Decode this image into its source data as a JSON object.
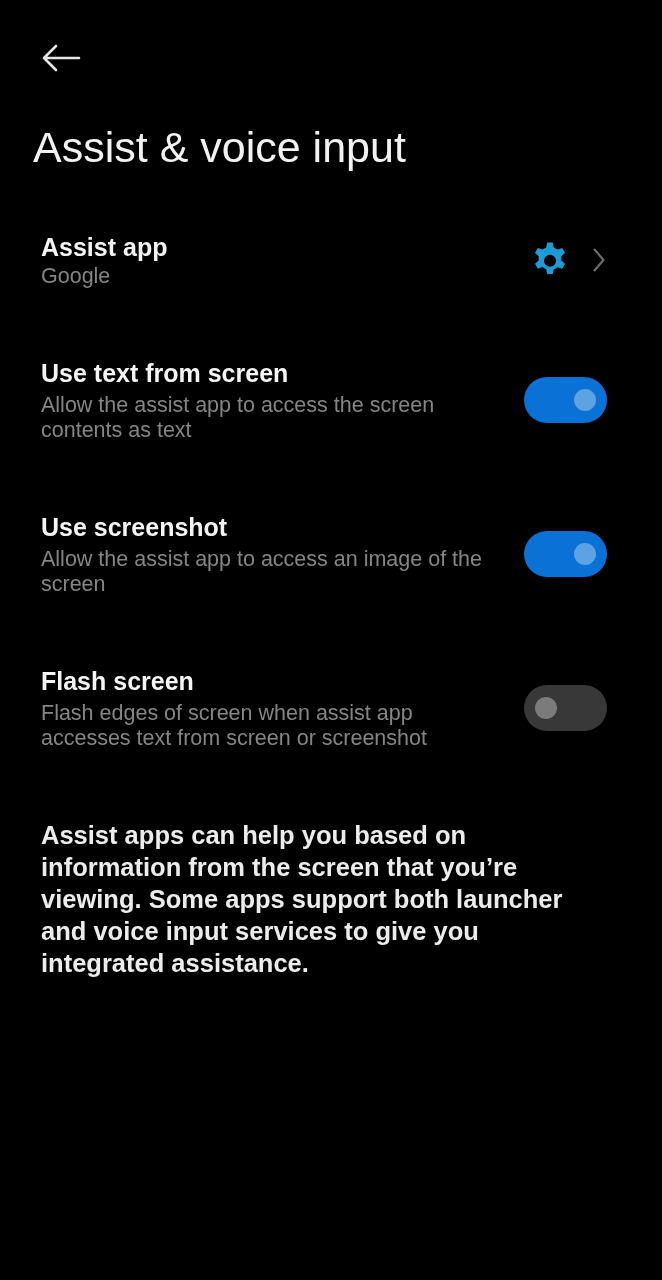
{
  "title": "Assist & voice input",
  "settings": [
    {
      "kind": "link",
      "title": "Assist app",
      "summary": "Google"
    },
    {
      "kind": "toggle",
      "title": "Use text from screen",
      "summary": "Allow the assist app to access the screen contents as text",
      "on": true
    },
    {
      "kind": "toggle",
      "title": "Use screenshot",
      "summary": "Allow the assist app to access an image of the screen",
      "on": true
    },
    {
      "kind": "toggle",
      "title": "Flash screen",
      "summary": "Flash edges of screen when assist app accesses text from screen or screenshot",
      "on": false
    }
  ],
  "footer_text": "Assist apps can help you based on information from the screen that you’re viewing. Some apps support both launcher and voice input services to give you integrated assistance."
}
